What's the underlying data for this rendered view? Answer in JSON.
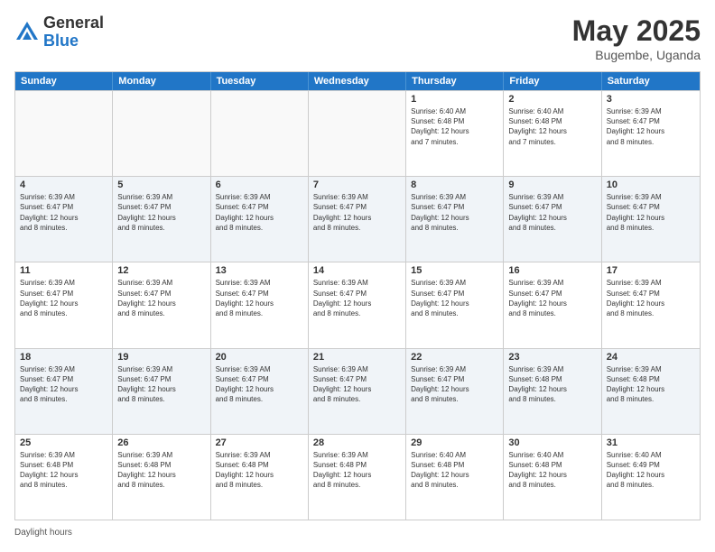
{
  "header": {
    "logo_general": "General",
    "logo_blue": "Blue",
    "title": "May 2025",
    "location": "Bugembe, Uganda"
  },
  "calendar": {
    "days_of_week": [
      "Sunday",
      "Monday",
      "Tuesday",
      "Wednesday",
      "Thursday",
      "Friday",
      "Saturday"
    ],
    "rows": [
      {
        "alt": false,
        "cells": [
          {
            "day": "",
            "info": ""
          },
          {
            "day": "",
            "info": ""
          },
          {
            "day": "",
            "info": ""
          },
          {
            "day": "",
            "info": ""
          },
          {
            "day": "1",
            "info": "Sunrise: 6:40 AM\nSunset: 6:48 PM\nDaylight: 12 hours\nand 7 minutes."
          },
          {
            "day": "2",
            "info": "Sunrise: 6:40 AM\nSunset: 6:48 PM\nDaylight: 12 hours\nand 7 minutes."
          },
          {
            "day": "3",
            "info": "Sunrise: 6:39 AM\nSunset: 6:47 PM\nDaylight: 12 hours\nand 8 minutes."
          }
        ]
      },
      {
        "alt": true,
        "cells": [
          {
            "day": "4",
            "info": "Sunrise: 6:39 AM\nSunset: 6:47 PM\nDaylight: 12 hours\nand 8 minutes."
          },
          {
            "day": "5",
            "info": "Sunrise: 6:39 AM\nSunset: 6:47 PM\nDaylight: 12 hours\nand 8 minutes."
          },
          {
            "day": "6",
            "info": "Sunrise: 6:39 AM\nSunset: 6:47 PM\nDaylight: 12 hours\nand 8 minutes."
          },
          {
            "day": "7",
            "info": "Sunrise: 6:39 AM\nSunset: 6:47 PM\nDaylight: 12 hours\nand 8 minutes."
          },
          {
            "day": "8",
            "info": "Sunrise: 6:39 AM\nSunset: 6:47 PM\nDaylight: 12 hours\nand 8 minutes."
          },
          {
            "day": "9",
            "info": "Sunrise: 6:39 AM\nSunset: 6:47 PM\nDaylight: 12 hours\nand 8 minutes."
          },
          {
            "day": "10",
            "info": "Sunrise: 6:39 AM\nSunset: 6:47 PM\nDaylight: 12 hours\nand 8 minutes."
          }
        ]
      },
      {
        "alt": false,
        "cells": [
          {
            "day": "11",
            "info": "Sunrise: 6:39 AM\nSunset: 6:47 PM\nDaylight: 12 hours\nand 8 minutes."
          },
          {
            "day": "12",
            "info": "Sunrise: 6:39 AM\nSunset: 6:47 PM\nDaylight: 12 hours\nand 8 minutes."
          },
          {
            "day": "13",
            "info": "Sunrise: 6:39 AM\nSunset: 6:47 PM\nDaylight: 12 hours\nand 8 minutes."
          },
          {
            "day": "14",
            "info": "Sunrise: 6:39 AM\nSunset: 6:47 PM\nDaylight: 12 hours\nand 8 minutes."
          },
          {
            "day": "15",
            "info": "Sunrise: 6:39 AM\nSunset: 6:47 PM\nDaylight: 12 hours\nand 8 minutes."
          },
          {
            "day": "16",
            "info": "Sunrise: 6:39 AM\nSunset: 6:47 PM\nDaylight: 12 hours\nand 8 minutes."
          },
          {
            "day": "17",
            "info": "Sunrise: 6:39 AM\nSunset: 6:47 PM\nDaylight: 12 hours\nand 8 minutes."
          }
        ]
      },
      {
        "alt": true,
        "cells": [
          {
            "day": "18",
            "info": "Sunrise: 6:39 AM\nSunset: 6:47 PM\nDaylight: 12 hours\nand 8 minutes."
          },
          {
            "day": "19",
            "info": "Sunrise: 6:39 AM\nSunset: 6:47 PM\nDaylight: 12 hours\nand 8 minutes."
          },
          {
            "day": "20",
            "info": "Sunrise: 6:39 AM\nSunset: 6:47 PM\nDaylight: 12 hours\nand 8 minutes."
          },
          {
            "day": "21",
            "info": "Sunrise: 6:39 AM\nSunset: 6:47 PM\nDaylight: 12 hours\nand 8 minutes."
          },
          {
            "day": "22",
            "info": "Sunrise: 6:39 AM\nSunset: 6:47 PM\nDaylight: 12 hours\nand 8 minutes."
          },
          {
            "day": "23",
            "info": "Sunrise: 6:39 AM\nSunset: 6:48 PM\nDaylight: 12 hours\nand 8 minutes."
          },
          {
            "day": "24",
            "info": "Sunrise: 6:39 AM\nSunset: 6:48 PM\nDaylight: 12 hours\nand 8 minutes."
          }
        ]
      },
      {
        "alt": false,
        "cells": [
          {
            "day": "25",
            "info": "Sunrise: 6:39 AM\nSunset: 6:48 PM\nDaylight: 12 hours\nand 8 minutes."
          },
          {
            "day": "26",
            "info": "Sunrise: 6:39 AM\nSunset: 6:48 PM\nDaylight: 12 hours\nand 8 minutes."
          },
          {
            "day": "27",
            "info": "Sunrise: 6:39 AM\nSunset: 6:48 PM\nDaylight: 12 hours\nand 8 minutes."
          },
          {
            "day": "28",
            "info": "Sunrise: 6:39 AM\nSunset: 6:48 PM\nDaylight: 12 hours\nand 8 minutes."
          },
          {
            "day": "29",
            "info": "Sunrise: 6:40 AM\nSunset: 6:48 PM\nDaylight: 12 hours\nand 8 minutes."
          },
          {
            "day": "30",
            "info": "Sunrise: 6:40 AM\nSunset: 6:48 PM\nDaylight: 12 hours\nand 8 minutes."
          },
          {
            "day": "31",
            "info": "Sunrise: 6:40 AM\nSunset: 6:49 PM\nDaylight: 12 hours\nand 8 minutes."
          }
        ]
      }
    ]
  },
  "footer": {
    "daylight_label": "Daylight hours"
  }
}
